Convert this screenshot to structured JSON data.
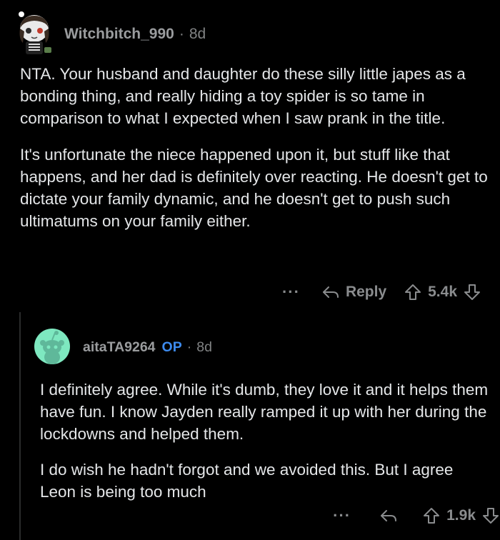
{
  "comments": [
    {
      "username": "Witchbitch_990",
      "separator": "·",
      "age": "8d",
      "paragraphs": [
        "NTA. Your husband and daughter do these silly little japes as a bonding thing, and really hiding a toy spider is so tame in comparison to what I expected when I saw prank in the title.",
        "It's unfortunate the niece happened upon it, but stuff like that happens, and her dad is definitely over reacting. He doesn't get to dictate your family dynamic, and he doesn't get to push such ultimatums on your family either."
      ],
      "actions": {
        "more": "···",
        "reply_label": "Reply",
        "score": "5.4k"
      }
    },
    {
      "username": "aitaTA9264",
      "op_badge": "OP",
      "separator": "·",
      "age": "8d",
      "paragraphs": [
        "I definitely agree. While it's dumb, they love it and it helps them have fun. I know Jayden really ramped it up with her during the lockdowns and helped them.",
        "I do wish he hadn't forgot and we avoided this. But I agree Leon is being too much"
      ],
      "actions": {
        "more": "···",
        "score": "1.9k"
      }
    }
  ],
  "colors": {
    "background": "#000000",
    "text": "#e4e6e8",
    "meta": "#818384",
    "op_badge": "#3d8bef",
    "reply_avatar_bg": "#7ee8c0"
  },
  "icons": {
    "avatar_1": "witch-skeleton-avatar-icon",
    "avatar_2": "snoo-avatar-icon",
    "reply": "reply-arrow-icon",
    "upvote": "upvote-arrow-icon",
    "downvote": "downvote-arrow-icon"
  }
}
